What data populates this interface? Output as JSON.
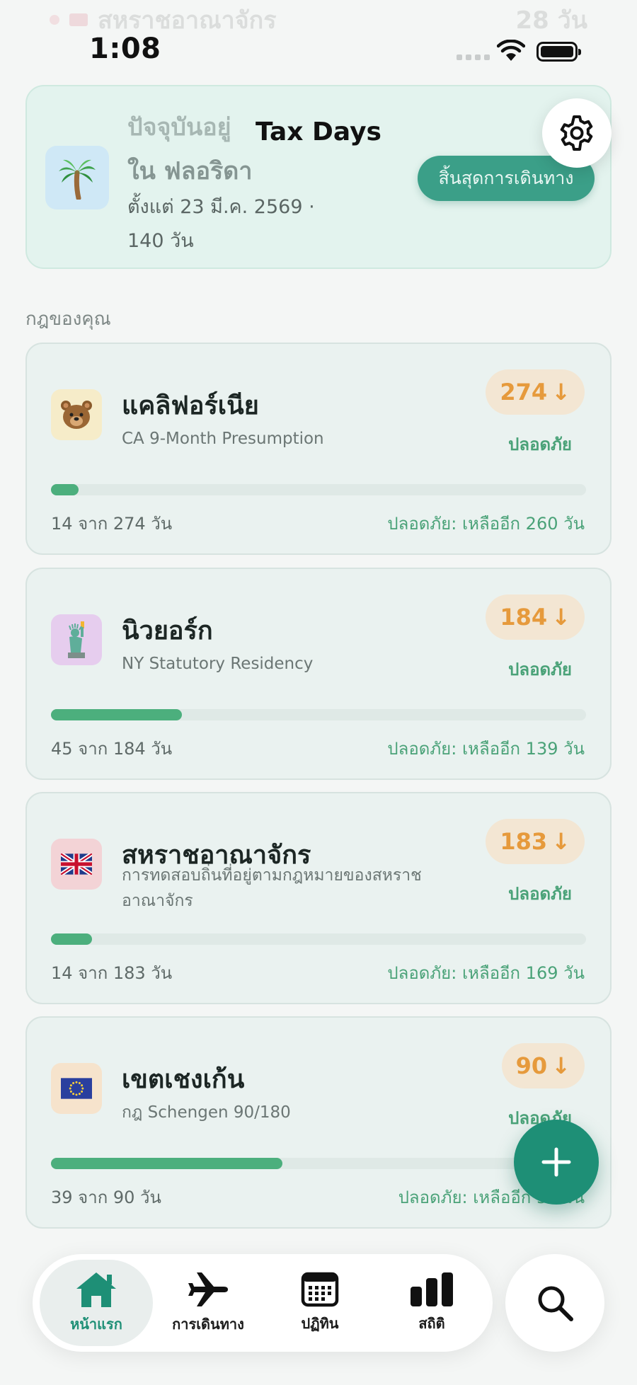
{
  "ghost_row": {
    "title": "สหราชอาณาจักร",
    "days": "28 วัน"
  },
  "status_bar": {
    "time": "1:08"
  },
  "header": {
    "title": "Tax Days"
  },
  "current_location": {
    "label": "ปัจจุบันอยู่",
    "place": "ใน ฟลอริดา",
    "since": "ตั้งแต่ 23 มี.ค. 2569 ·",
    "days": "140 วัน",
    "end_trip_label": "สิ้นสุดการเดินทาง",
    "icon": "palm-tree-icon"
  },
  "section_label": "กฎของคุณ",
  "rules": [
    {
      "title": "แคลิฟอร์เนีย",
      "subtitle": "CA 9-Month Presumption",
      "limit": "274",
      "status": "ปลอดภัย",
      "progress_fraction": 0.051,
      "used": "14 จาก 274 วัน",
      "remaining": "ปลอดภัย: เหลืออีก 260 วัน",
      "icon": "bear-icon",
      "icon_bg": "#f6ecc9"
    },
    {
      "title": "นิวยอร์ก",
      "subtitle": "NY Statutory Residency",
      "limit": "184",
      "status": "ปลอดภัย",
      "progress_fraction": 0.245,
      "used": "45 จาก 184 วัน",
      "remaining": "ปลอดภัย: เหลืออีก 139 วัน",
      "icon": "statue-of-liberty-icon",
      "icon_bg": "#e6cdee"
    },
    {
      "title": "สหราชอาณาจักร",
      "subtitle": "การทดสอบถิ่นที่อยู่ตามกฎหมายของสหราชอาณาจักร",
      "limit": "183",
      "status": "ปลอดภัย",
      "progress_fraction": 0.077,
      "used": "14 จาก 183 วัน",
      "remaining": "ปลอดภัย: เหลืออีก 169 วัน",
      "icon": "uk-flag-icon",
      "icon_bg": "#f3d3d6"
    },
    {
      "title": "เขตเชงเก้น",
      "subtitle": "กฎ Schengen 90/180",
      "limit": "90",
      "status": "ปลอดภัย",
      "progress_fraction": 0.433,
      "used": "39 จาก 90 วัน",
      "remaining": "ปลอดภัย: เหลืออีก 51 วัน",
      "icon": "eu-flag-icon",
      "icon_bg": "#f6e3cc"
    }
  ],
  "tabs": [
    {
      "label": "หน้าแรก",
      "icon": "home-icon",
      "active": true
    },
    {
      "label": "การเดินทาง",
      "icon": "airplane-icon",
      "active": false
    },
    {
      "label": "ปฏิทิน",
      "icon": "calendar-icon",
      "active": false
    },
    {
      "label": "สถิติ",
      "icon": "bar-chart-icon",
      "active": false
    }
  ],
  "colors": {
    "accent": "#1e8f76",
    "safe": "#4aa278",
    "badge_text": "#e69a3c",
    "progress": "#4caf7d"
  }
}
